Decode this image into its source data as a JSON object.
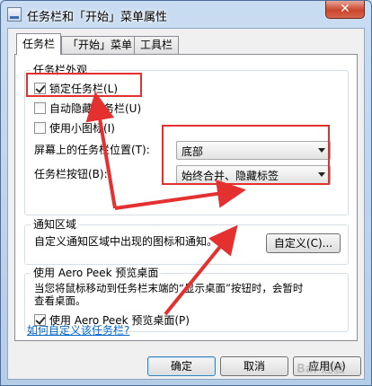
{
  "window": {
    "title": "任务栏和「开始」菜单属性",
    "close_glyph": "✕"
  },
  "tabs": [
    {
      "label": "任务栏",
      "active": true
    },
    {
      "label": "「开始」菜单",
      "active": false
    },
    {
      "label": "工具栏",
      "active": false
    }
  ],
  "appearance": {
    "label": "任务栏外观",
    "lock_taskbar": {
      "label": "锁定任务栏(L)",
      "checked": true
    },
    "auto_hide": {
      "label": "自动隐藏任务栏(U)",
      "checked": false
    },
    "small_icons": {
      "label": "使用小图标(I)",
      "checked": false
    },
    "location": {
      "label": "屏幕上的任务栏位置(T):",
      "value": "底部"
    },
    "buttons": {
      "label": "任务栏按钮(B):",
      "value": "始终合并、隐藏标签"
    }
  },
  "notification": {
    "label": "通知区域",
    "text": "自定义通知区域中出现的图标和通知。",
    "customize_button": "自定义(C)..."
  },
  "aero_peek": {
    "label": "使用 Aero Peek 预览桌面",
    "description_line1": "当您将鼠标移动到任务栏末端的“显示桌面”按钮时，会暂时",
    "description_line2": "查看桌面。",
    "checkbox": {
      "label": "使用 Aero Peek 预览桌面(P)",
      "checked": true
    }
  },
  "help_link": "如何自定义该任务栏?",
  "buttons": {
    "ok": "确定",
    "cancel": "取消",
    "apply": "应用(A)"
  },
  "watermark": "Bai 经验",
  "colors": {
    "annotation": "#e53030",
    "link": "#0066cc",
    "title_bar": "#c9dcf1"
  }
}
